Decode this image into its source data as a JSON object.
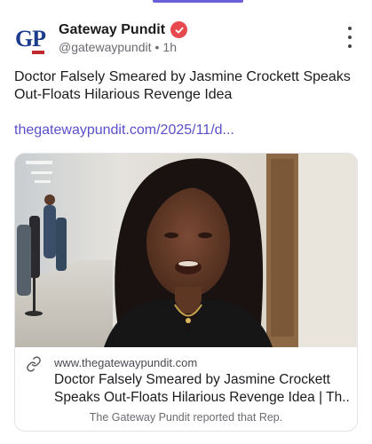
{
  "post": {
    "author_name": "Gateway Pundit",
    "handle": "@gatewaypundit",
    "separator": "•",
    "age": "1h",
    "avatar_text": "GP",
    "verified_icon": "verified-check-icon",
    "more_icon": "vertical-dots-icon",
    "text_line1": "Doctor Falsely Smeared by Jasmine Crockett Speaks",
    "text_line2": "Out-Floats Hilarious Revenge Idea",
    "link": "thegatewaypundit.com/2025/11/d..."
  },
  "card": {
    "domain": "www.thegatewaypundit.com",
    "title_line1": "Doctor Falsely Smeared by Jasmine Crockett",
    "title_line2": "Speaks Out-Floats Hilarious Revenge Idea | Th...",
    "description": "The Gateway Pundit reported that Rep.",
    "link_icon": "link-chain-icon"
  },
  "colors": {
    "accent": "#5a50c9",
    "verified": "#e8494f",
    "brand_blue": "#1b3b8c",
    "brand_red": "#c0282d"
  }
}
